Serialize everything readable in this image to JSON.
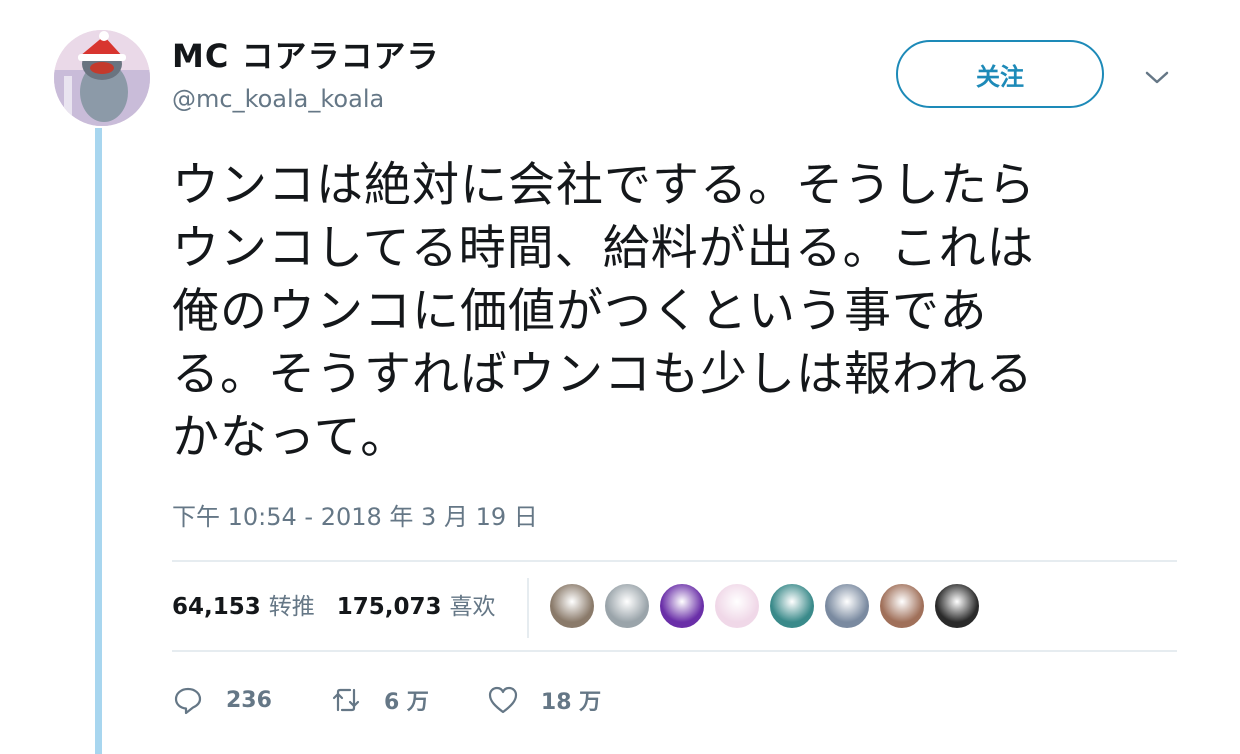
{
  "header": {
    "display_name": "MC コアラコアラ",
    "handle": "@mc_koala_koala",
    "follow_label": "关注"
  },
  "tweet": {
    "text": "ウンコは絶対に会社でする。そうしたら\nウンコしてる時間、給料が出る。これは\n俺のウンコに価値がつくという事であ\nる。そうすればウンコも少しは報われる\nかなって。",
    "timestamp": "下午 10:54 - 2018 年 3 月 19 日"
  },
  "stats": {
    "retweets_count": "64,153",
    "retweets_label": "转推",
    "likes_count": "175,073",
    "likes_label": "喜欢"
  },
  "likers": [
    {
      "icon": "liker-avatar",
      "color": "#8a7a6a"
    },
    {
      "icon": "liker-avatar",
      "color": "#9aa4aa"
    },
    {
      "icon": "liker-avatar",
      "color": "#6a2fa8"
    },
    {
      "icon": "liker-avatar",
      "color": "#f0d8e8"
    },
    {
      "icon": "liker-avatar",
      "color": "#3a8a8a"
    },
    {
      "icon": "liker-avatar",
      "color": "#7a8aa0"
    },
    {
      "icon": "liker-avatar",
      "color": "#a0705a"
    },
    {
      "icon": "liker-avatar",
      "color": "#2a2a2a"
    }
  ],
  "actions": {
    "reply_count": "236",
    "retweet_count": "6 万",
    "like_count": "18 万"
  },
  "colors": {
    "accent": "#1d8ab8",
    "thread_line": "#a8d6ef",
    "muted": "#657786",
    "text": "#14171a"
  }
}
